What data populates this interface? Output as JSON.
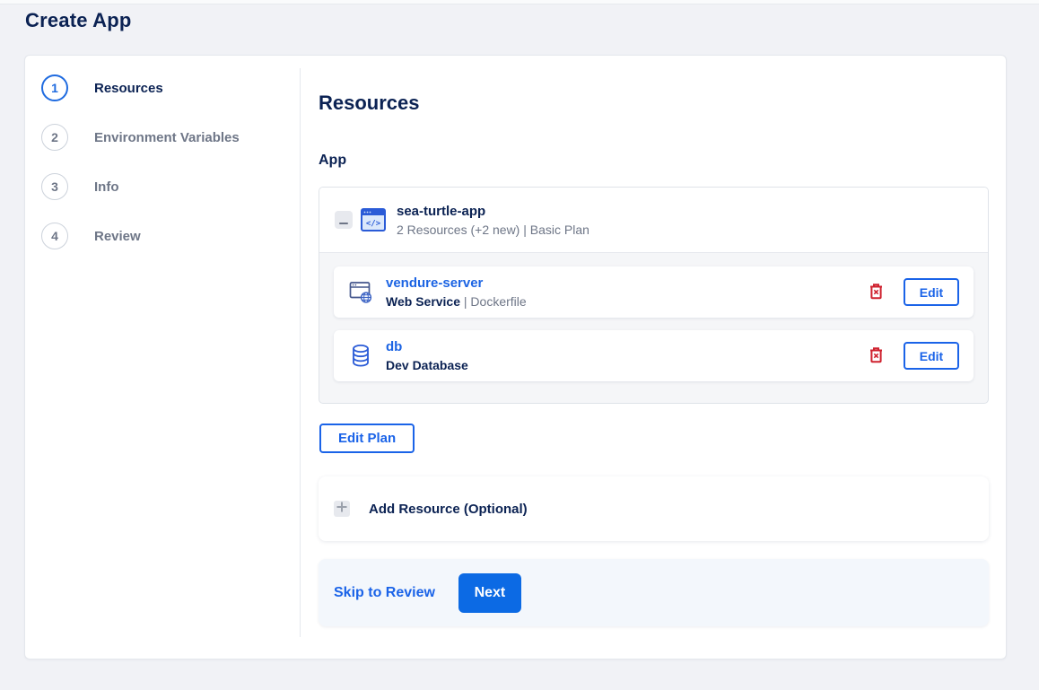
{
  "page_title": "Create App",
  "colors": {
    "accent": "#0c6ae4",
    "link_blue": "#1c64e3",
    "navy_text": "#0b2253",
    "danger_red": "#cf212e",
    "page_background": "#f1f2f6"
  },
  "stepper": {
    "steps": [
      {
        "number": "1",
        "label": "Resources",
        "active": true
      },
      {
        "number": "2",
        "label": "Environment Variables",
        "active": false
      },
      {
        "number": "3",
        "label": "Info",
        "active": false
      },
      {
        "number": "4",
        "label": "Review",
        "active": false
      }
    ]
  },
  "main": {
    "heading": "Resources",
    "section_label": "App",
    "app_group": {
      "name": "sea-turtle-app",
      "summary": "2 Resources (+2 new) | Basic Plan",
      "resources": [
        {
          "name": "vendure-server",
          "subtitle_bold": "Web Service",
          "subtitle_rest": " | Dockerfile",
          "icon": "web-service-icon",
          "edit_label": "Edit"
        },
        {
          "name": "db",
          "subtitle_bold": "Dev Database",
          "subtitle_rest": "",
          "icon": "database-icon",
          "edit_label": "Edit"
        }
      ]
    },
    "edit_plan_label": "Edit Plan",
    "add_resource_label": "Add Resource (Optional)"
  },
  "footer": {
    "skip_label": "Skip to Review",
    "next_label": "Next"
  }
}
